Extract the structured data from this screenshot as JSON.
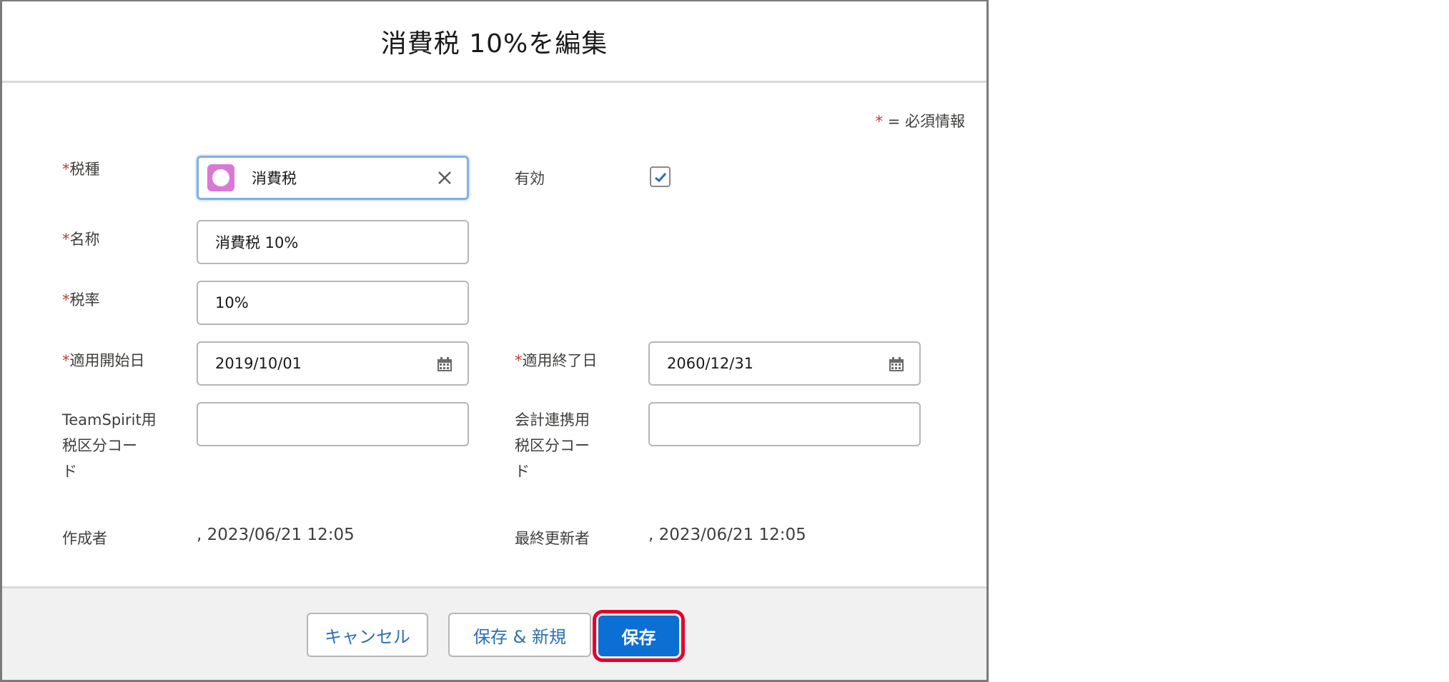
{
  "modal": {
    "title": "消費税 10%を編集",
    "required_note_star": "*",
    "required_note_text": " = 必須情報"
  },
  "form": {
    "tax_type": {
      "star": "*",
      "label": "税種",
      "value": "消費税"
    },
    "active": {
      "label": "有効",
      "checked": true
    },
    "name": {
      "star": "*",
      "label": "名称",
      "value": "消費税 10%"
    },
    "tax_rate": {
      "star": "*",
      "label": "税率",
      "value": "10%"
    },
    "start_date": {
      "star": "*",
      "label": "適用開始日",
      "value": "2019/10/01"
    },
    "end_date": {
      "star": "*",
      "label": "適用終了日",
      "value": "2060/12/31"
    },
    "ts_tax_code": {
      "label_line1": "TeamSpirit用",
      "label_line2": "税区分コー",
      "label_line3": "ド",
      "value": ""
    },
    "acct_tax_code": {
      "label_line1": "会計連携用",
      "label_line2": "税区分コー",
      "label_line3": "ド",
      "value": ""
    },
    "created_by": {
      "label": "作成者",
      "value": ", 2023/06/21 12:05"
    },
    "modified_by": {
      "label": "最終更新者",
      "value": ", 2023/06/21 12:05"
    }
  },
  "footer": {
    "cancel": "キャンセル",
    "save_new": "保存 & 新規",
    "save": "保存"
  },
  "colors": {
    "primary": "#0b6fd4",
    "required": "#c23934",
    "highlight": "#e4002b",
    "lookup_icon": "#d87ad4"
  }
}
